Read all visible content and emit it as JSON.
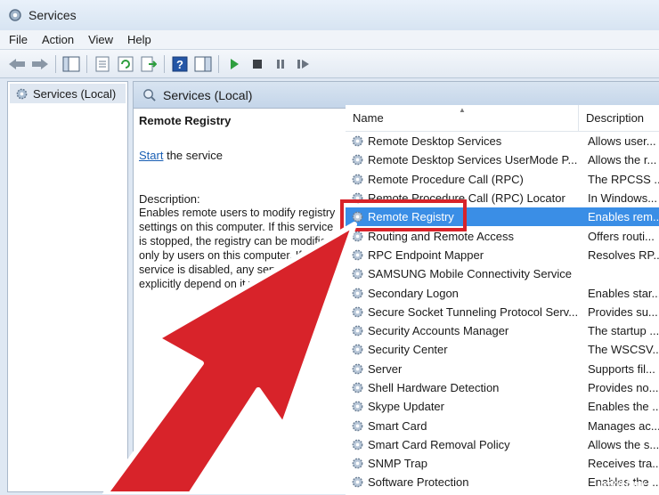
{
  "window": {
    "title": "Services"
  },
  "menu": [
    "File",
    "Action",
    "View",
    "Help"
  ],
  "toolbar": {
    "icons": [
      "back-icon",
      "forward-icon",
      "show-hide-tree-icon",
      "properties-icon",
      "refresh-icon",
      "export-list-icon",
      "help-icon",
      "show-action-pane-icon",
      "play-icon",
      "stop-icon",
      "pause-icon",
      "restart-icon"
    ]
  },
  "tree": {
    "item": "Services (Local)"
  },
  "pane": {
    "header": "Services (Local)"
  },
  "detail": {
    "title": "Remote Registry",
    "start_link": "Start",
    "start_rest": " the service",
    "description_label": "Description:",
    "description_text": "Enables remote users to modify registry settings on this computer. If this service is stopped, the registry can be modified only by users on this computer. If this service is disabled, any services that explicitly depend on it will fail to start."
  },
  "list": {
    "columns": {
      "name": "Name",
      "description": "Description"
    },
    "rows": [
      {
        "name": "Remote Desktop Services",
        "description": "Allows user..."
      },
      {
        "name": "Remote Desktop Services UserMode P...",
        "description": "Allows the r..."
      },
      {
        "name": "Remote Procedure Call (RPC)",
        "description": "The RPCSS ..."
      },
      {
        "name": "Remote Procedure Call (RPC) Locator",
        "description": "In Windows..."
      },
      {
        "name": "Remote Registry",
        "description": "Enables rem...",
        "selected": true
      },
      {
        "name": "Routing and Remote Access",
        "description": "Offers routi..."
      },
      {
        "name": "RPC Endpoint Mapper",
        "description": "Resolves RP..."
      },
      {
        "name": "SAMSUNG Mobile Connectivity Service",
        "description": ""
      },
      {
        "name": "Secondary Logon",
        "description": "Enables star..."
      },
      {
        "name": "Secure Socket Tunneling Protocol Serv...",
        "description": "Provides su..."
      },
      {
        "name": "Security Accounts Manager",
        "description": "The startup ..."
      },
      {
        "name": "Security Center",
        "description": "The WSCSV..."
      },
      {
        "name": "Server",
        "description": "Supports fil..."
      },
      {
        "name": "Shell Hardware Detection",
        "description": "Provides no..."
      },
      {
        "name": "Skype Updater",
        "description": "Enables the ..."
      },
      {
        "name": "Smart Card",
        "description": "Manages ac..."
      },
      {
        "name": "Smart Card Removal Policy",
        "description": "Allows the s..."
      },
      {
        "name": "SNMP Trap",
        "description": "Receives tra..."
      },
      {
        "name": "Software Protection",
        "description": "Enables the ..."
      }
    ]
  },
  "watermark": "wikiHow",
  "colors": {
    "selection": "#3a8ee6",
    "annotation": "#d8232a"
  }
}
